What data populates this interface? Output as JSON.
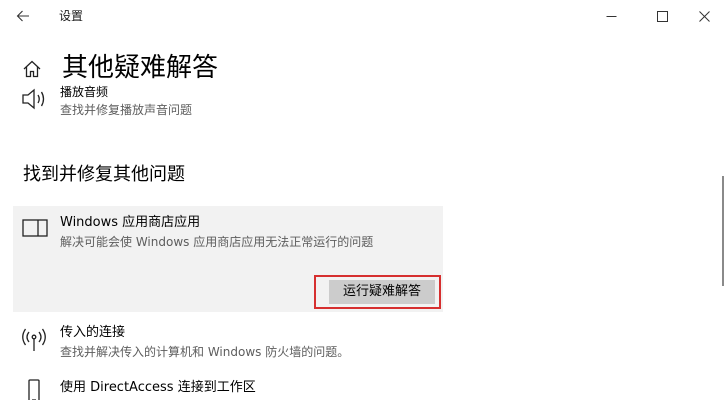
{
  "window": {
    "title": "设置",
    "back_icon": "back-arrow-icon",
    "controls": [
      "minimize-icon",
      "maximize-icon",
      "close-icon"
    ]
  },
  "header": {
    "home_icon": "home-icon",
    "title": "其他疑难解答"
  },
  "top_item": {
    "icon": "speaker-icon",
    "title": "播放音频",
    "description": "查找并修复播放声音问题"
  },
  "section": {
    "heading": "找到并修复其他问题"
  },
  "items": [
    {
      "icon": "app-window-icon",
      "title": "Windows 应用商店应用",
      "description": "解决可能会使 Windows 应用商店应用无法正常运行的问题",
      "selected": true,
      "button_label": "运行疑难解答"
    },
    {
      "icon": "antenna-icon",
      "title": "传入的连接",
      "description": "查找并解决传入的计算机和 Windows 防火墙的问题。"
    },
    {
      "icon": "phone-icon",
      "title": "使用 DirectAccess 连接到工作区"
    }
  ],
  "colors": {
    "selected_background": "#f2f2f2",
    "button_background": "#cccccc",
    "highlight_outline": "#d62f2f",
    "secondary_text": "#5d5d5d"
  }
}
